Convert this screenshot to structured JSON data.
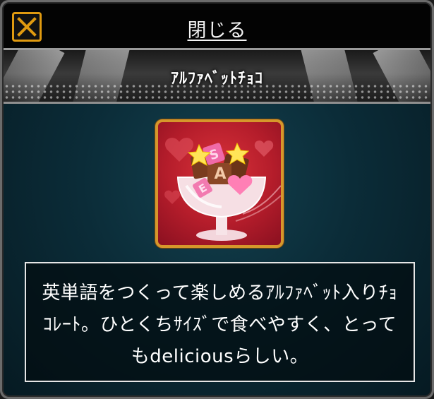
{
  "header": {
    "close_label": "閉じる",
    "close_icon": "close-x-icon",
    "accent_color": "#e09a10"
  },
  "item": {
    "name": "ｱﾙﾌｧﾍﾞｯﾄﾁｮｺ",
    "icon": "alphabet-chocolate-parfait-icon",
    "description": "英単語をつくって楽しめるｱﾙﾌｧﾍﾞｯﾄ入りﾁｮｺﾚｰﾄ。ひとくちｻｲｽﾞで食べやすく、とってもdeliciousらしい。",
    "letters": [
      "S",
      "A",
      "E"
    ],
    "frame_color": "#d6972b",
    "background_color": "#c42432"
  }
}
